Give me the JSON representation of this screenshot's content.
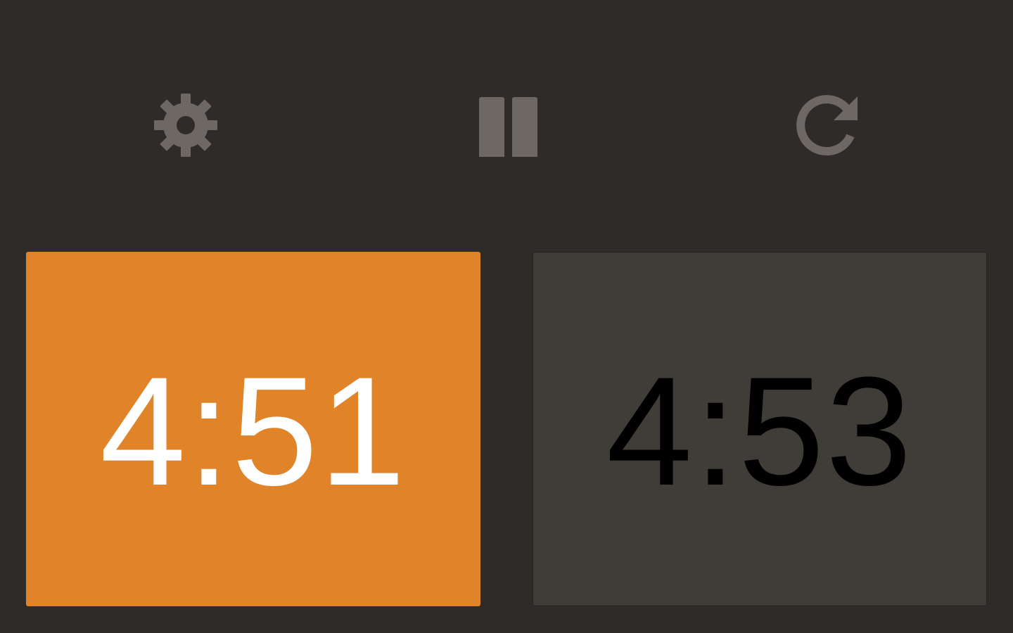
{
  "colors": {
    "background": "#2f2b29",
    "icon": "#6e6865",
    "active_clock_bg": "#e18328",
    "active_clock_text": "#ffffff",
    "inactive_clock_bg": "#403d39",
    "inactive_clock_text": "#000000"
  },
  "toolbar": {
    "settings_icon": "gear-icon",
    "pause_icon": "pause-icon",
    "reset_icon": "reset-icon"
  },
  "clocks": {
    "left": {
      "time": "4:51",
      "active": true
    },
    "right": {
      "time": "4:53",
      "active": false
    }
  }
}
